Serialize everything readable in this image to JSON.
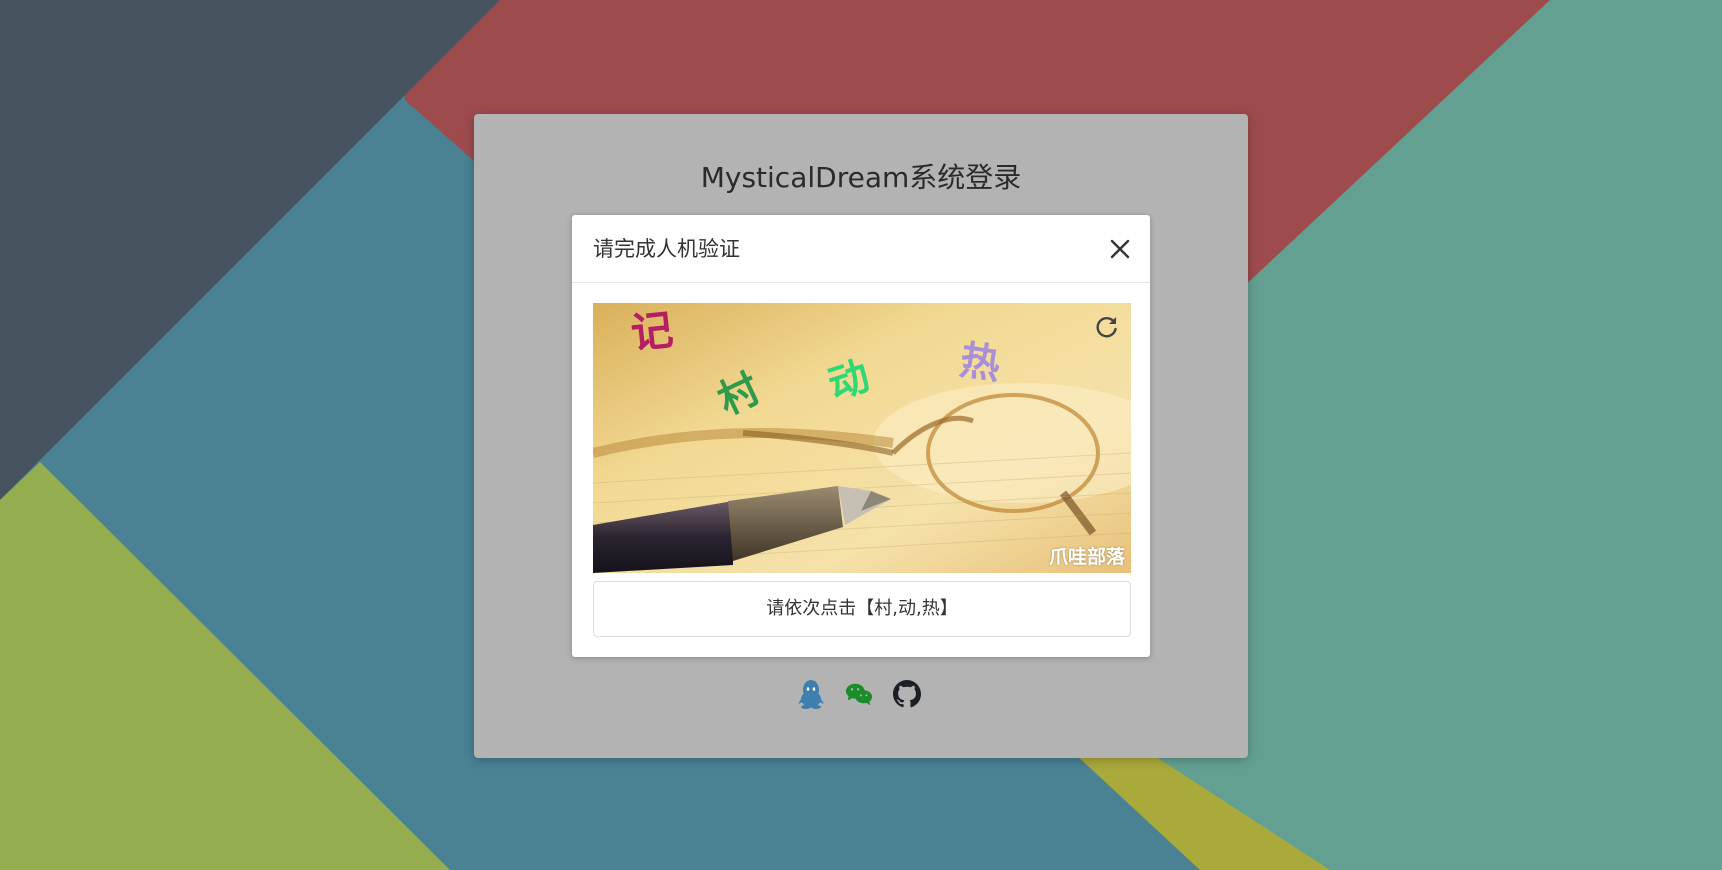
{
  "login": {
    "title": "MysticalDream系统登录"
  },
  "captcha_dialog": {
    "title": "请完成人机验证",
    "prompt": "请依次点击【村,动,热】",
    "characters": [
      {
        "char": "记",
        "color": "#b41e63"
      },
      {
        "char": "村",
        "color": "#2e9a4c"
      },
      {
        "char": "动",
        "color": "#2fd874"
      },
      {
        "char": "热",
        "color": "#a98fd6"
      }
    ],
    "watermark": "爪哇部落"
  },
  "social_login": [
    {
      "name": "qq",
      "icon": "qq-icon",
      "color": "#3f7fae"
    },
    {
      "name": "wechat",
      "icon": "wechat-icon",
      "color": "#1a8d2a"
    },
    {
      "name": "github",
      "icon": "github-icon",
      "color": "#1b1f23"
    }
  ],
  "colors": {
    "panel": "#b3b3b3",
    "background_teal": "#4a8294",
    "background_red": "#9e4b4d",
    "background_green": "#93ad4f",
    "background_seafoam": "#64a091",
    "background_slate": "#45545e",
    "background_olive": "#aaa93c"
  }
}
